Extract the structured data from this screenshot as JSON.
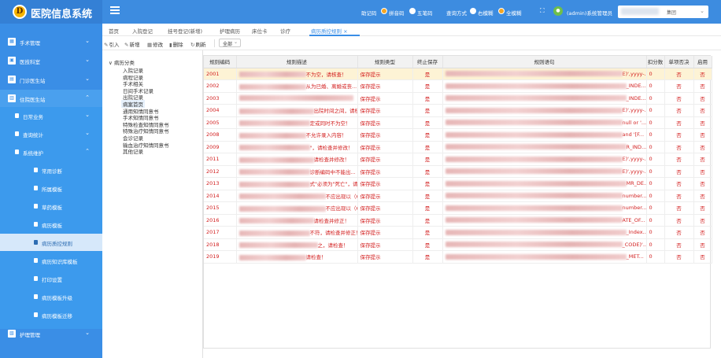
{
  "header": {
    "logo_char": "D",
    "title": "医院信息系统",
    "radio_group1_label": "助记码",
    "radio_group1": [
      "拼音码",
      "五笔码"
    ],
    "radio_group2_label": "查询方式",
    "radio_group2": [
      "右模糊",
      "全模糊"
    ],
    "user": "(admin)系统管理员",
    "dept_value": "集团"
  },
  "sidebar": [
    {
      "label": "手术管理",
      "icon": "surgery-icon"
    },
    {
      "label": "医技科室",
      "icon": "lab-icon"
    },
    {
      "label": "门诊医生站",
      "icon": "clinic-icon"
    },
    {
      "label": "住院医生站",
      "icon": "ward-icon"
    },
    {
      "label": "日常业务",
      "icon": "daily-icon"
    },
    {
      "label": "查询统计",
      "icon": "stats-icon"
    },
    {
      "label": "系统维护",
      "icon": "maintenance-icon"
    },
    {
      "label": "常用诊断"
    },
    {
      "label": "所属模板"
    },
    {
      "label": "草药模板"
    },
    {
      "label": "病历模板"
    },
    {
      "label": "病历质控规则"
    },
    {
      "label": "病历知识库模板"
    },
    {
      "label": "打印设置"
    },
    {
      "label": "病历模板升级"
    },
    {
      "label": "病历模板迁移"
    },
    {
      "label": "护理管理",
      "icon": "nursing-icon"
    }
  ],
  "tabs": [
    "首页",
    "入院登记",
    "挂号登记(新增)",
    "护理病历",
    "床位卡",
    "诊疗",
    "病历质控规则 ×"
  ],
  "toolbar": {
    "import": "引入",
    "add": "新增",
    "edit": "修改",
    "delete": "删除",
    "refresh": "刷新",
    "filter_value": "全部"
  },
  "tree": {
    "root": "病历分类",
    "items": [
      "入院记录",
      "病程记录",
      "手术相关",
      "日间手术记录",
      "出院记录",
      "病案首页",
      "通用知情同意书",
      "手术知情同意书",
      "特殊检查知情同意书",
      "特殊治疗知情同意书",
      "会诊记录",
      "输血治疗知情同意书",
      "其他记录"
    ],
    "selected": "病案首页"
  },
  "table": {
    "columns": [
      "规则编码",
      "规则描述",
      "规则类型",
      "终止保存",
      "规则语句",
      "扣分数",
      "单项否决",
      "启用"
    ],
    "rows": [
      {
        "code": "2001",
        "desc": "不为空，请核查！",
        "type": "保存提示",
        "stop": "是",
        "sql": "E)',yyyy-...",
        "score": "0",
        "veto": "否",
        "enabled": "否"
      },
      {
        "code": "2002",
        "desc": "从为已婚、离婚或丧...",
        "type": "保存提示",
        "stop": "是",
        "sql": "_INDE...",
        "score": "0",
        "veto": "否",
        "enabled": "否"
      },
      {
        "code": "2003",
        "desc": "",
        "type": "保存提示",
        "stop": "是",
        "sql": "_INDE...",
        "score": "0",
        "veto": "否",
        "enabled": "否"
      },
      {
        "code": "2004",
        "desc": "出院时间之间，请核...",
        "type": "保存提示",
        "stop": "是",
        "sql": "E)',yyyy-...",
        "score": "0",
        "veto": "否",
        "enabled": "否"
      },
      {
        "code": "2005",
        "desc": "定或同时不为空！",
        "type": "保存提示",
        "stop": "是",
        "sql": "null or '...",
        "score": "0",
        "veto": "否",
        "enabled": "否"
      },
      {
        "code": "2008",
        "desc": "不允许录入内容！",
        "type": "保存提示",
        "stop": "是",
        "sql": "and '[F...",
        "score": "0",
        "veto": "否",
        "enabled": "否"
      },
      {
        "code": "2009",
        "desc": "\"，请检查并修改！",
        "type": "保存提示",
        "stop": "是",
        "sql": "R_IND...",
        "score": "0",
        "veto": "否",
        "enabled": "否"
      },
      {
        "code": "2011",
        "desc": "请检查并修改！",
        "type": "保存提示",
        "stop": "是",
        "sql": "E)',yyyy-...",
        "score": "0",
        "veto": "否",
        "enabled": "否"
      },
      {
        "code": "2012",
        "desc": "诊断编码中不能出...",
        "type": "保存提示",
        "stop": "是",
        "sql": "E)',yyyy-...",
        "score": "0",
        "veto": "否",
        "enabled": "否"
      },
      {
        "code": "2013",
        "desc": "式\"必须为\"死亡\"，请...",
        "type": "保存提示",
        "stop": "是",
        "sql": "MR_DE...",
        "score": "0",
        "veto": "否",
        "enabled": "否"
      },
      {
        "code": "2014",
        "desc": "不应出现以（65-75）...",
        "type": "保存提示",
        "stop": "是",
        "sql": "number...",
        "score": "0",
        "veto": "否",
        "enabled": "否"
      },
      {
        "code": "2015",
        "desc": "不应出现以（60-64）...",
        "type": "保存提示",
        "stop": "是",
        "sql": "number...",
        "score": "0",
        "veto": "否",
        "enabled": "否"
      },
      {
        "code": "2016",
        "desc": "请检查并修正！",
        "type": "保存提示",
        "stop": "是",
        "sql": "ATE_OF...",
        "score": "0",
        "veto": "否",
        "enabled": "否"
      },
      {
        "code": "2017",
        "desc": "不符，请检查并修正！",
        "type": "保存提示",
        "stop": "是",
        "sql": "_Index...",
        "score": "0",
        "veto": "否",
        "enabled": "否"
      },
      {
        "code": "2018",
        "desc": "之，请检查！",
        "type": "保存提示",
        "stop": "是",
        "sql": "_CODE)'...",
        "score": "0",
        "veto": "否",
        "enabled": "否"
      },
      {
        "code": "2019",
        "desc": "请检查！",
        "type": "保存提示",
        "stop": "是",
        "sql": "_MET...",
        "score": "0",
        "veto": "否",
        "enabled": "否"
      }
    ]
  },
  "colors": {
    "header": "#3d8ce0",
    "sidebar": "#3a8ee6",
    "row_text": "#d32020",
    "highlight_row": "#fdf3d5",
    "radio_on": "#f5a623"
  }
}
